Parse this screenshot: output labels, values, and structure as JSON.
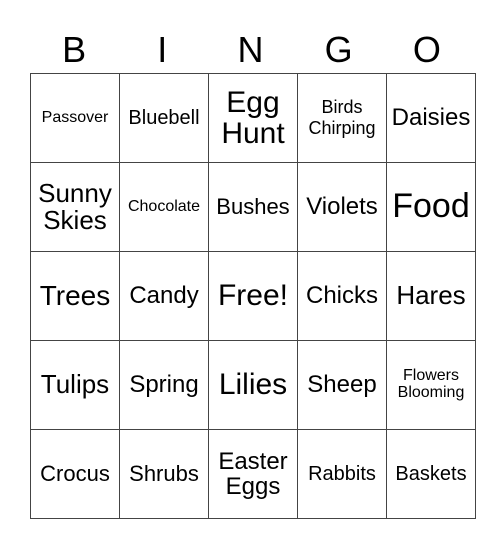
{
  "header": {
    "letters": [
      "B",
      "I",
      "N",
      "G",
      "O"
    ]
  },
  "board": {
    "rows": [
      [
        "Passover",
        "Bluebell",
        "Egg Hunt",
        "Birds Chirping",
        "Daisies"
      ],
      [
        "Sunny Skies",
        "Chocolate",
        "Bushes",
        "Violets",
        "Food"
      ],
      [
        "Trees",
        "Candy",
        "Free!",
        "Chicks",
        "Hares"
      ],
      [
        "Tulips",
        "Spring",
        "Lilies",
        "Sheep",
        "Flowers Blooming"
      ],
      [
        "Crocus",
        "Shrubs",
        "Easter Eggs",
        "Rabbits",
        "Baskets"
      ]
    ]
  }
}
